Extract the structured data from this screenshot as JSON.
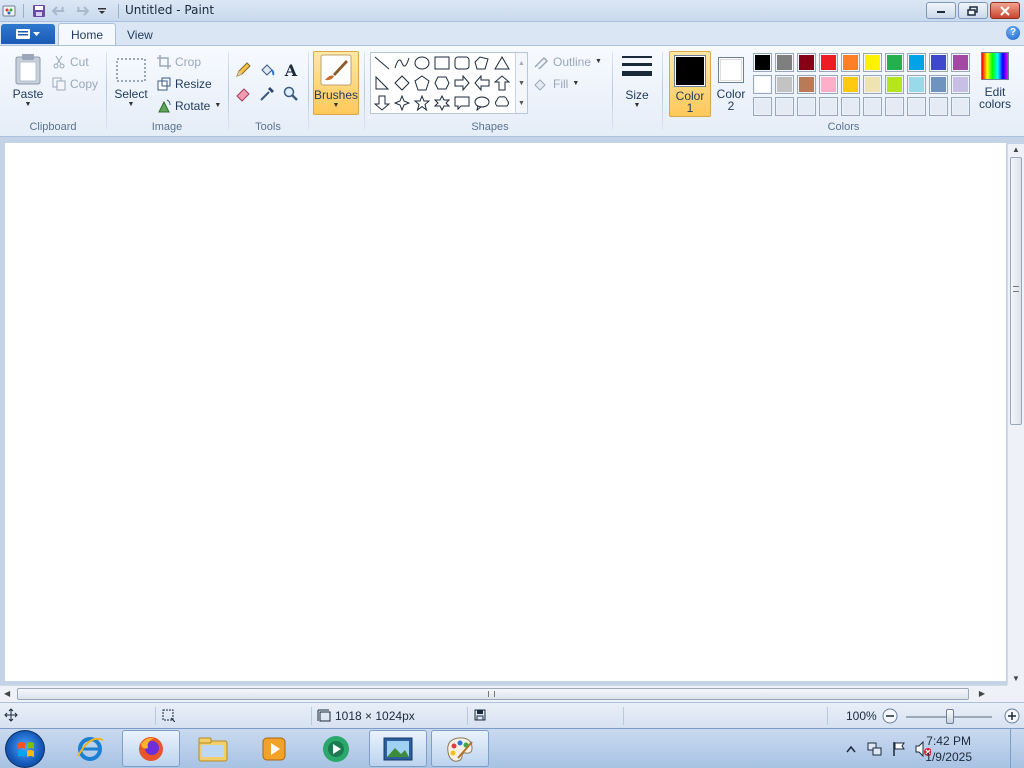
{
  "window": {
    "title": "Untitled - Paint",
    "app_menu_icon": "paint-menu-icon",
    "quick_access": [
      "save-icon",
      "undo-icon",
      "redo-icon",
      "customize-qat-icon"
    ],
    "controls": [
      "minimize-icon",
      "restore-icon",
      "close-icon"
    ]
  },
  "tabs": [
    {
      "label": "Home",
      "active": true
    },
    {
      "label": "View",
      "active": false
    }
  ],
  "ribbon": {
    "clipboard": {
      "label": "Clipboard",
      "paste": "Paste",
      "cut": "Cut",
      "copy": "Copy"
    },
    "image": {
      "label": "Image",
      "select": "Select",
      "crop": "Crop",
      "resize": "Resize",
      "rotate": "Rotate"
    },
    "tools": {
      "label": "Tools",
      "items": [
        "pencil-icon",
        "fill-bucket-icon",
        "text-icon",
        "eraser-icon",
        "color-picker-icon",
        "magnifier-icon"
      ]
    },
    "brushes": {
      "label": "Brushes"
    },
    "shapes": {
      "label": "Shapes",
      "outline": "Outline",
      "fill": "Fill"
    },
    "size": {
      "label": "Size"
    },
    "colors": {
      "label": "Colors",
      "color1_label_a": "Color",
      "color1_label_b": "1",
      "color2_label_a": "Color",
      "color2_label_b": "2",
      "color1": "#000000",
      "color2": "#ffffff",
      "edit_a": "Edit",
      "edit_b": "colors",
      "palette_row1": [
        "#000000",
        "#7f7f7f",
        "#880015",
        "#ed1c24",
        "#ff7f27",
        "#fff200",
        "#22b14c",
        "#00a2e8",
        "#3f48cc",
        "#a349a4"
      ],
      "palette_row2": [
        "#ffffff",
        "#c3c3c3",
        "#b97a57",
        "#ffaec9",
        "#ffc90e",
        "#efe4b0",
        "#b5e61d",
        "#99d9ea",
        "#7092be",
        "#c8bfe7"
      ]
    }
  },
  "statusbar": {
    "image_size": "1018 × 1024px",
    "zoom": "100%"
  },
  "taskbar": {
    "apps": [
      "internet-explorer-icon",
      "firefox-icon",
      "file-explorer-icon",
      "media-player-icon",
      "media-center-icon",
      "photo-viewer-icon",
      "paint-icon"
    ],
    "time": "7:42 PM",
    "date": "1/9/2025"
  }
}
